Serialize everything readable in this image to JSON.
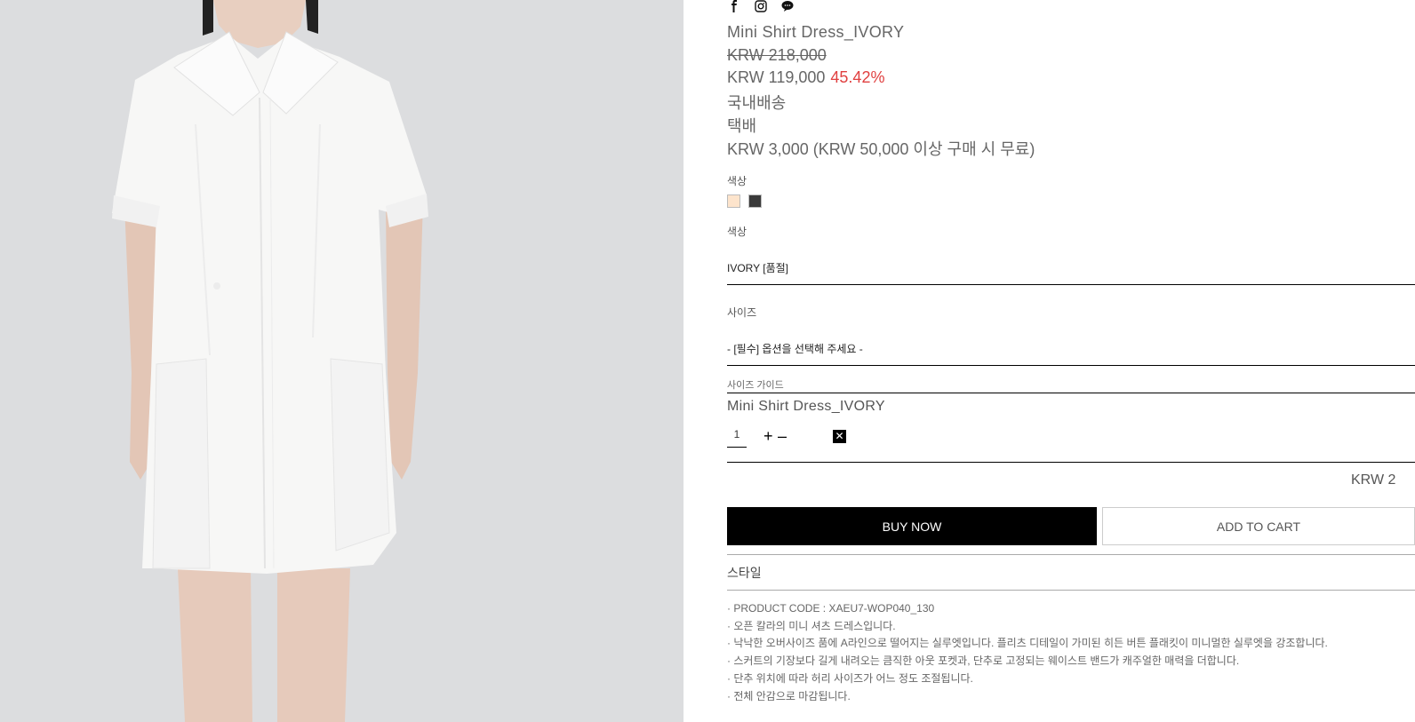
{
  "product": {
    "title": "Mini Shirt Dress_IVORY",
    "original_price": "KRW 218,000",
    "sale_price": "KRW 119,000",
    "discount": "45.42%",
    "shipping_region": "국내배송",
    "shipping_method": "택배",
    "shipping_fee": "KRW 3,000 (KRW 50,000 이상 구매 시 무료)"
  },
  "social": {
    "icons": [
      "facebook-icon",
      "instagram-icon",
      "kakaotalk-icon"
    ]
  },
  "color_swatch": {
    "label": "색상",
    "swatches": [
      {
        "name": "IVORY",
        "color": "#fde4cc"
      },
      {
        "name": "BLACK",
        "color": "#3a3a3a"
      }
    ]
  },
  "color_select": {
    "label": "색상",
    "value": "IVORY [품절]"
  },
  "size_select": {
    "label": "사이즈",
    "value": "- [필수] 옵션을 선택해 주세요 -"
  },
  "size_guide": "사이즈 가이드",
  "selected_item": {
    "name": "Mini Shirt Dress_IVORY",
    "quantity": "1",
    "plus": "+",
    "minus": "–",
    "remove": "✕"
  },
  "total": "KRW 2",
  "actions": {
    "buy_now": "BUY NOW",
    "add_to_cart": "ADD TO CART"
  },
  "style_tab": "스타일",
  "description": [
    "· PRODUCT CODE : XAEU7-WOP040_130",
    "· 오픈 칼라의 미니 셔츠 드레스입니다.",
    "· 낙낙한 오버사이즈 품에 A라인으로 떨어지는 실루엣입니다. 플리츠 디테일이 가미된 히든 버튼 플래킷이 미니멀한 실루엣을 강조합니다.",
    "· 스커트의 기장보다 길게 내려오는 큼직한 아웃 포켓과, 단추로 고정되는 웨이스트 밴드가 캐주얼한 매력을 더합니다.",
    "· 단추 위치에 따라 허리 사이즈가 어느 정도 조절됩니다.",
    "· 전체 안감으로 마감됩니다."
  ],
  "colors": {
    "discount": "#e04040",
    "buy_button": "#000000",
    "photo_background": "#dcdddf"
  }
}
